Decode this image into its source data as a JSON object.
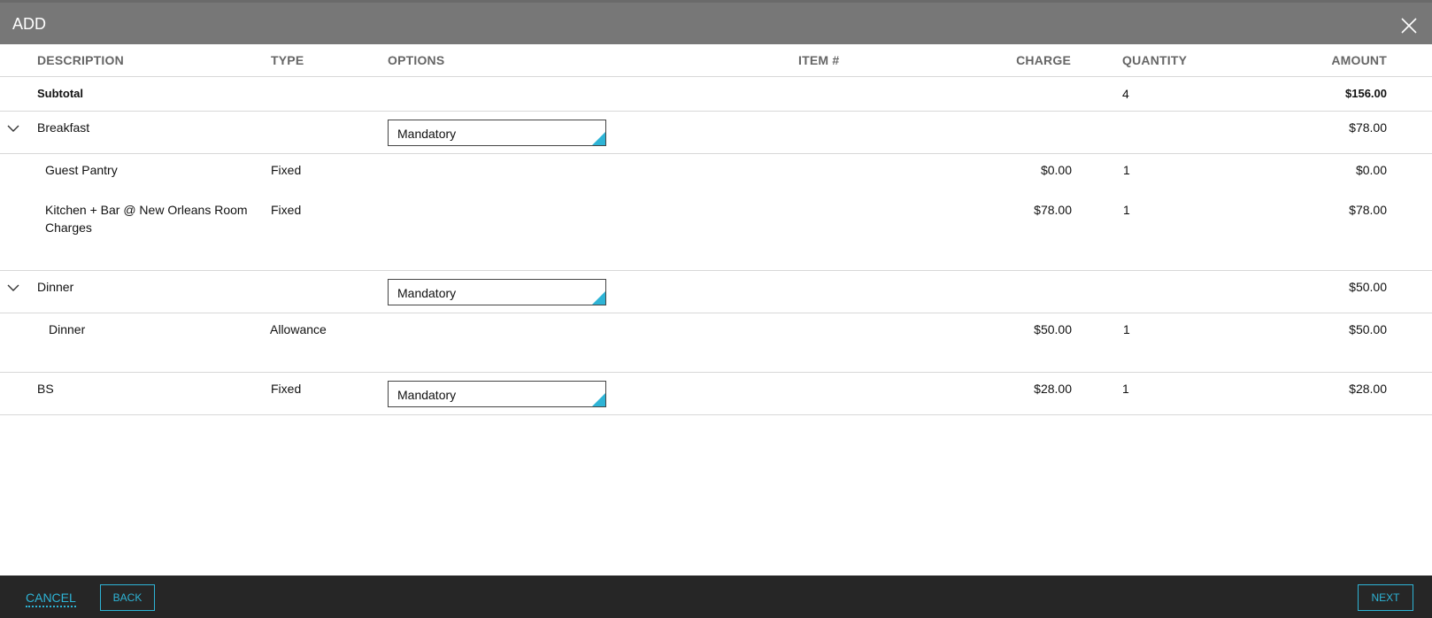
{
  "dialog": {
    "title": "ADD"
  },
  "columns": {
    "description": "DESCRIPTION",
    "type": "TYPE",
    "options": "OPTIONS",
    "item": "ITEM #",
    "charge": "CHARGE",
    "quantity": "QUANTITY",
    "amount": "AMOUNT"
  },
  "subtotal": {
    "label": "Subtotal",
    "quantity": "4",
    "amount": "$156.00"
  },
  "groups": {
    "breakfast": {
      "label": "Breakfast",
      "option": "Mandatory",
      "amount": "$78.00",
      "items": [
        {
          "description": "Guest Pantry",
          "type": "Fixed",
          "charge": "$0.00",
          "quantity": "1",
          "amount": "$0.00"
        },
        {
          "description_line1": "Kitchen + Bar @ New Orleans Room",
          "description_line2": "Charges",
          "type": "Fixed",
          "charge": "$78.00",
          "quantity": "1",
          "amount": "$78.00"
        }
      ]
    },
    "dinner": {
      "label": "Dinner",
      "option": "Mandatory",
      "amount": "$50.00",
      "items": [
        {
          "description": "Dinner",
          "type": "Allowance",
          "charge": "$50.00",
          "quantity": "1",
          "amount": "$50.00"
        }
      ]
    },
    "bs": {
      "label": "BS",
      "type": "Fixed",
      "option": "Mandatory",
      "charge": "$28.00",
      "quantity": "1",
      "amount": "$28.00"
    }
  },
  "footer": {
    "cancel": "CANCEL",
    "back": "BACK",
    "next": "NEXT"
  },
  "colors": {
    "accent": "#2eb4d6",
    "titlebar": "#777777",
    "footer": "#262626"
  }
}
